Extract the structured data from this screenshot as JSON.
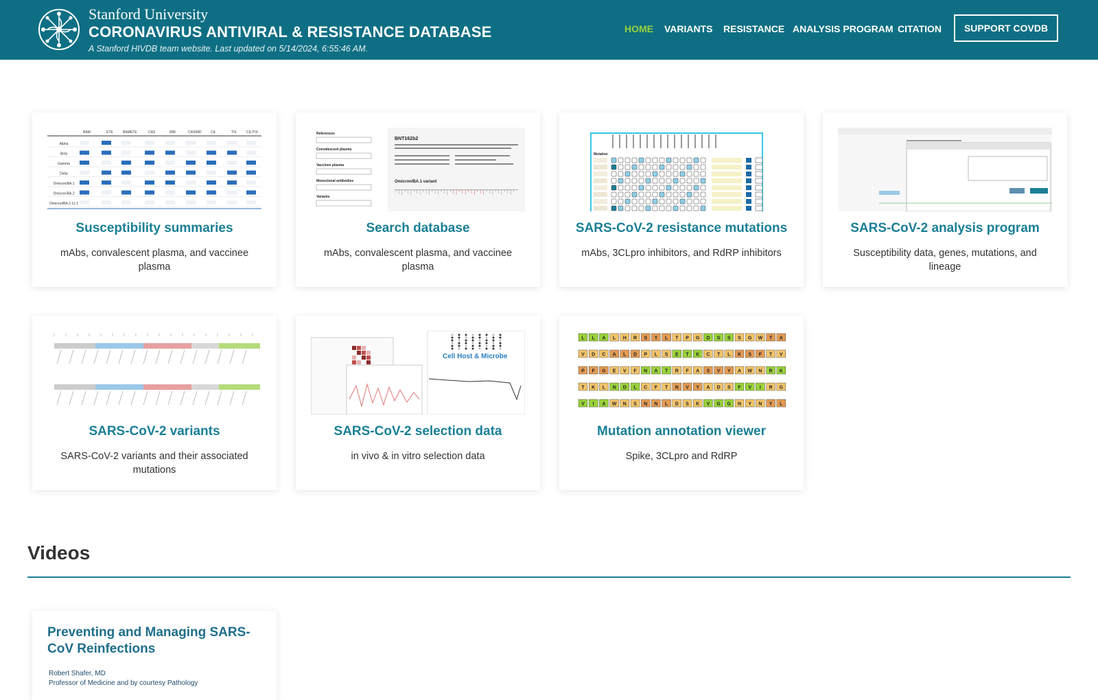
{
  "header": {
    "university": "Stanford University",
    "title": "CORONAVIRUS ANTIVIRAL & RESISTANCE DATABASE",
    "subtitle": "A Stanford HIVDB team website. Last updated on 5/14/2024, 6:55:46 AM.",
    "nav": [
      {
        "label": "HOME",
        "active": true
      },
      {
        "label": "VARIANTS",
        "active": false
      },
      {
        "label": "RESISTANCE",
        "active": false
      },
      {
        "label": "ANALYSIS PROGRAM",
        "active": false
      },
      {
        "label": "CITATION",
        "active": false
      }
    ],
    "support_label": "SUPPORT COVDB"
  },
  "cards": [
    {
      "title": "Susceptibility summaries",
      "desc": "mAbs, convalescent plasma, and vaccinee plasma"
    },
    {
      "title": "Search database",
      "desc": "mAbs, convalescent plasma, and vaccinee plasma"
    },
    {
      "title": "SARS-CoV-2 resistance mutations",
      "desc": "mAbs, 3CLpro inhibitors, and RdRP inhibitors"
    },
    {
      "title": "SARS-CoV-2 analysis program",
      "desc": "Susceptibility data, genes, mutations, and lineage"
    },
    {
      "title": "SARS-CoV-2 variants",
      "desc": "SARS-CoV-2 variants and their associated mutations"
    },
    {
      "title": "SARS-CoV-2 selection data",
      "desc": "in vivo & in vitro selection data"
    },
    {
      "title": "Mutation annotation viewer",
      "desc": "Spike, 3CLpro and RdRP"
    }
  ],
  "thumbs": {
    "susceptibility_rows": [
      "Alpha",
      "Beta",
      "Gamma",
      "Delta",
      "Omicron/BA.1",
      "Omicron/BA.2",
      "Omicron/BA.2.12.1"
    ],
    "search_fields": [
      "References",
      "Convalescent plasma",
      "Vaccinee plasma",
      "Monoclonal antibodies",
      "Variants"
    ],
    "search_heading": "BNT162b2",
    "selection_journal": "Cell Host & Microbe",
    "annotation_rows": [
      "LLALHRSYLTPGDSSSGWTA",
      "VDCALDPLSETKCTLKSFTV",
      "PFGEVFNATRFASVYAWNRK",
      "TKLNDLCFTNVYADSFVIRG",
      "VIAWNSNNLDSKVGGNYNYL"
    ]
  },
  "videos": {
    "heading": "Videos",
    "items": [
      {
        "title": "Preventing and Managing SARS-CoV Reinfections",
        "author": "Robert Shafer, MD",
        "role": "Professor of Medicine and by courtesy Pathology"
      }
    ]
  },
  "colors": {
    "header_bg": "#0e6f84",
    "nav_active": "#9ad23b",
    "card_title": "#1a7f96"
  }
}
